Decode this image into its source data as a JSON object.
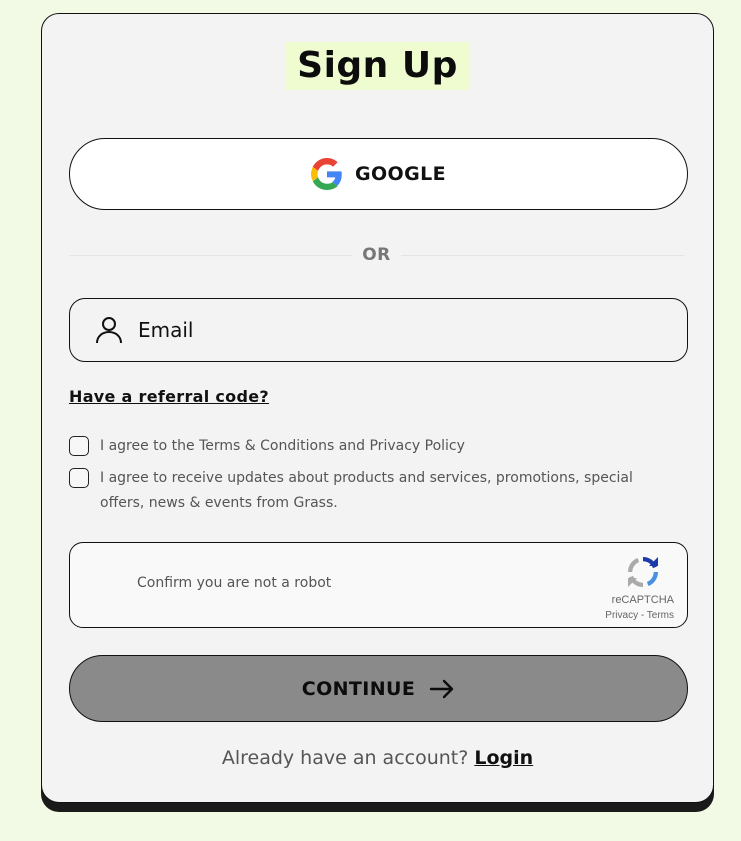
{
  "title": "Sign Up",
  "google_button": {
    "label": "GOOGLE",
    "icon": "google-logo-icon"
  },
  "divider": {
    "label": "OR"
  },
  "email": {
    "placeholder": "Email",
    "value": "",
    "icon": "user-icon"
  },
  "referral_link": "Have a referral code?",
  "checkboxes": [
    {
      "label": "I agree to the Terms & Conditions and Privacy Policy",
      "checked": false
    },
    {
      "label": "I agree to receive updates about products and services, promotions, special offers, news & events from Grass.",
      "checked": false
    }
  ],
  "captcha": {
    "text": "Confirm you are not a robot",
    "brand": "reCAPTCHA",
    "links": "Privacy - Terms"
  },
  "continue_button": {
    "label": "CONTINUE",
    "icon": "arrow-right-icon"
  },
  "footer": {
    "prompt": "Already have an account?",
    "login_link": "Login"
  },
  "colors": {
    "page_background": "#f2fae6",
    "card_background": "#f3f3f3",
    "title_highlight": "#eefcd0",
    "continue_background": "#8a8a8a"
  }
}
